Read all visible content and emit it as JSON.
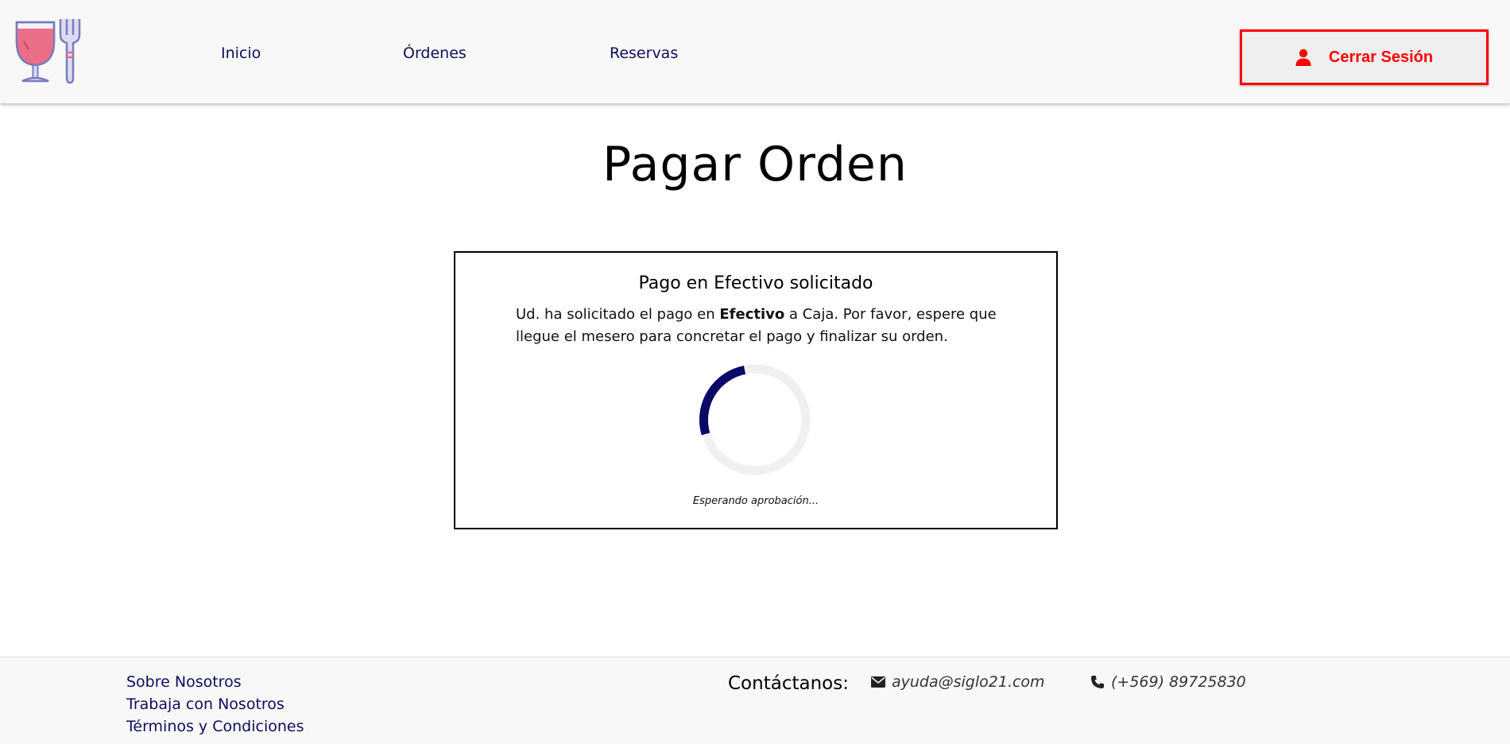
{
  "header": {
    "nav": [
      {
        "label": "Inicio"
      },
      {
        "label": "Órdenes"
      },
      {
        "label": "Reservas"
      }
    ],
    "logout_label": "Cerrar Sesión",
    "logout_color": "#ff0000",
    "icons": {
      "logo": "wine-glass-and-fork-logo",
      "logout": "user-icon"
    }
  },
  "main": {
    "title": "Pagar Orden",
    "card": {
      "title": "Pago en Efectivo solicitado",
      "text_part1": "Ud. ha solicitado el pago en ",
      "text_bold": "Efectivo",
      "text_part2": " a Caja. Por favor, espere que llegue el mesero para concretar el pago y finalizar su orden.",
      "status": "Esperando aprobación...",
      "spinner_color": "#0a0a66",
      "spinner_track_color": "#f0f0f0"
    }
  },
  "footer": {
    "links": [
      {
        "label": "Sobre Nosotros"
      },
      {
        "label": "Trabaja con Nosotros"
      },
      {
        "label": "Términos y Condiciones"
      }
    ],
    "contact_label": "Contáctanos:",
    "email": "ayuda@siglo21.com",
    "phone": "(+569) 89725830",
    "icons": {
      "email": "envelope-icon",
      "phone": "phone-icon"
    }
  }
}
